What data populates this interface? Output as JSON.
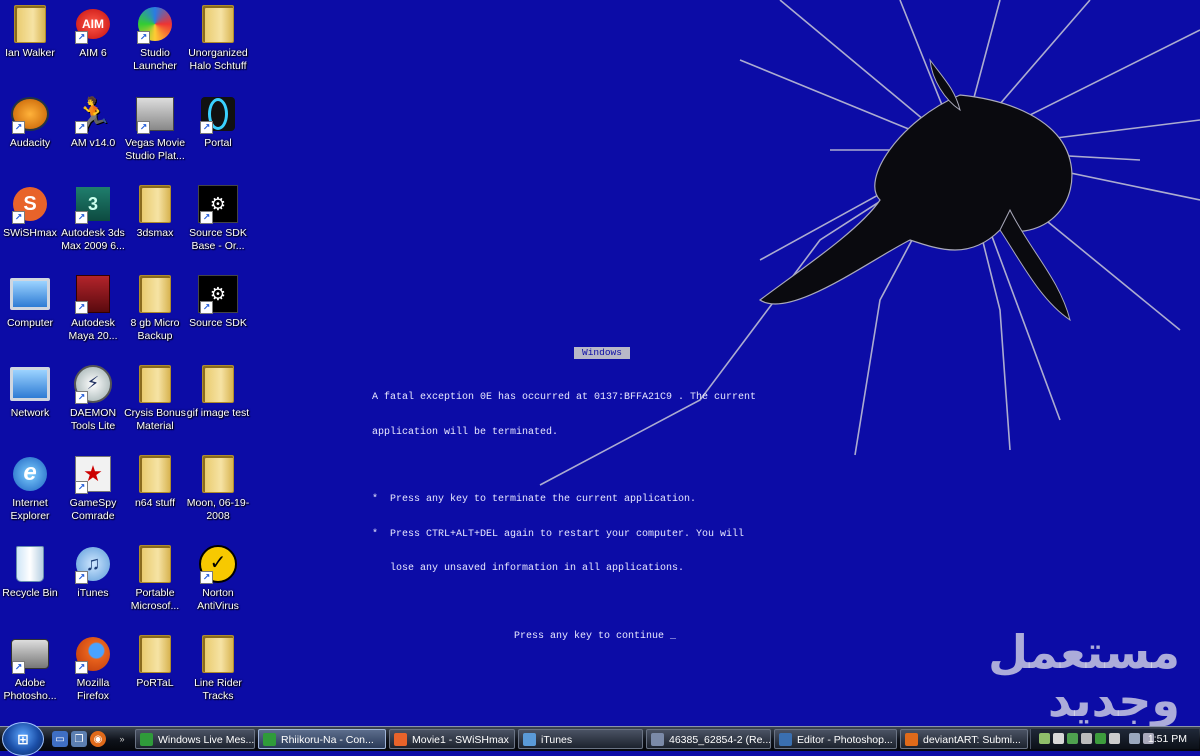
{
  "desktop": {
    "icons": [
      {
        "label": "Ian Walker",
        "icon": "folder-user-icon"
      },
      {
        "label": "AIM 6",
        "icon": "aim-icon"
      },
      {
        "label": "Studio Launcher",
        "icon": "studio-launcher-icon"
      },
      {
        "label": "Unorganized Halo Schtuff",
        "icon": "folder-icon"
      },
      {
        "label": "Audacity",
        "icon": "audacity-icon"
      },
      {
        "label": "AM v14.0",
        "icon": "aim-man-icon"
      },
      {
        "label": "Vegas Movie Studio Plat...",
        "icon": "vegas-icon"
      },
      {
        "label": "Portal",
        "icon": "portal-icon"
      },
      {
        "label": "SWiSHmax",
        "icon": "swishmax-icon"
      },
      {
        "label": "Autodesk 3ds Max 2009 6...",
        "icon": "3dsmax-icon"
      },
      {
        "label": "3dsmax",
        "icon": "folder-icon"
      },
      {
        "label": "Source SDK Base - Or...",
        "icon": "steam-icon"
      },
      {
        "label": "Computer",
        "icon": "computer-icon"
      },
      {
        "label": "Autodesk Maya 20...",
        "icon": "maya-icon"
      },
      {
        "label": "8 gb Micro Backup",
        "icon": "folder-icon"
      },
      {
        "label": "Source SDK",
        "icon": "steam-icon"
      },
      {
        "label": "Network",
        "icon": "network-icon"
      },
      {
        "label": "DAEMON Tools Lite",
        "icon": "daemon-tools-icon"
      },
      {
        "label": "Crysis Bonus Material",
        "icon": "folder-icon"
      },
      {
        "label": "gif image test",
        "icon": "folder-icon"
      },
      {
        "label": "Internet Explorer",
        "icon": "internet-explorer-icon"
      },
      {
        "label": "GameSpy Comrade",
        "icon": "gamespy-icon"
      },
      {
        "label": "n64 stuff",
        "icon": "folder-icon"
      },
      {
        "label": "Moon, 06-19-2008",
        "icon": "folder-icon"
      },
      {
        "label": "Recycle Bin",
        "icon": "recycle-bin-icon"
      },
      {
        "label": "iTunes",
        "icon": "itunes-icon"
      },
      {
        "label": "Portable Microsof...",
        "icon": "folder-icon"
      },
      {
        "label": "Norton AntiVirus",
        "icon": "norton-icon"
      },
      {
        "label": "Adobe Photosho...",
        "icon": "camera-icon"
      },
      {
        "label": "Mozilla Firefox",
        "icon": "firefox-icon"
      },
      {
        "label": "PoRTaL",
        "icon": "folder-icon"
      },
      {
        "label": "Line Rider Tracks",
        "icon": "folder-icon"
      }
    ]
  },
  "wallpaper": {
    "header": "Windows",
    "line1": "A fatal exception 0E has occurred at 0137:BFFA21C9 . The current",
    "line2": "application will be terminated.",
    "bullet1": "*  Press any key to terminate the current application.",
    "bullet2a": "*  Press CTRL+ALT+DEL again to restart your computer. You will",
    "bullet2b": "   lose any unsaved information in all applications.",
    "continue": "Press any key to continue _"
  },
  "watermark": {
    "line1": "مستعمل",
    "line2": "وجديد"
  },
  "taskbar": {
    "start_label": "⊞",
    "tasks": [
      {
        "label": "Windows Live Mes...",
        "icon": "messenger-icon"
      },
      {
        "label": "Rhiikoru-Na - Con...",
        "icon": "messenger-icon"
      },
      {
        "label": "Movie1 - SWiSHmax",
        "icon": "swishmax-icon"
      },
      {
        "label": "iTunes",
        "icon": "itunes-icon"
      },
      {
        "label": "46385_62854-2 (Re...",
        "icon": "image-icon"
      },
      {
        "label": "Editor - Photoshop...",
        "icon": "photoshop-icon"
      },
      {
        "label": "deviantART: Submi...",
        "icon": "firefox-icon"
      }
    ],
    "clock": "1:51 PM"
  },
  "colors": {
    "desktop_bg": "#0c0ca6",
    "taskbar": "#0e121a",
    "accent": "#1f5ad8"
  }
}
